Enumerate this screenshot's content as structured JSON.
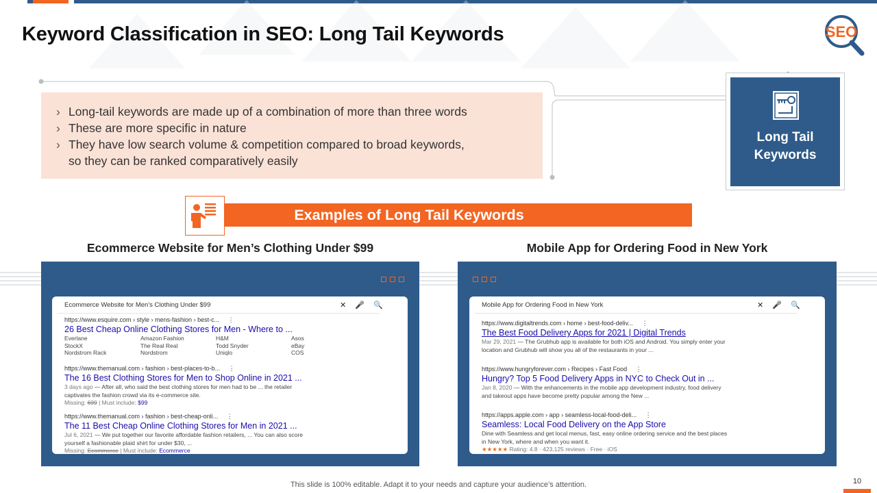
{
  "slide": {
    "title": "Keyword Classification in SEO: Long Tail Keywords",
    "logo_text": "SEO",
    "footer": "This slide is 100% editable. Adapt it to your needs and capture your audience’s attention.",
    "page_number": "10"
  },
  "bullets": [
    "Long-tail keywords are made up of a combination of more than three words",
    "These are more specific in nature",
    "They have low search volume & competition compared to broad keywords,",
    "so they can be ranked comparatively easily"
  ],
  "bullet_marker": "›",
  "keyword_box": {
    "line1": "Long Tail",
    "line2": "Keywords",
    "icon": "key-icon"
  },
  "examples_header": {
    "title": "Examples of Long Tail Keywords",
    "icon": "presenter-icon"
  },
  "left": {
    "caption": "Ecommerce Website for Men’s Clothing Under $99",
    "search": {
      "query": "Ecommerce Website for Men's Clothing Under $99",
      "clear": "✕",
      "mic": "🎤",
      "search": "🔍"
    },
    "results": [
      {
        "url": "https://www.esquire.com › style › mens-fashion › best-c...",
        "more": "⋮",
        "title": "26 Best Cheap Online Clothing Stores for Men - Where to ...",
        "grid": [
          "Everlane",
          "Amazon Fashion",
          "H&M",
          "Asos",
          "StockX",
          "The Real Real",
          "Todd Snyder",
          "eBay",
          "Nordstrom Rack",
          "Nordstrom",
          "Uniqlo",
          "COS"
        ]
      },
      {
        "url": "https://www.themanual.com › fashion › best-places-to-b...",
        "more": "⋮",
        "title": "The 16 Best Clothing Stores for Men to Shop Online in 2021 ...",
        "snippet1_date": "3 days ago",
        "snippet1": " — After all, who said the best clothing stores for men had to be ... the retailer",
        "snippet2": "captivates the fashion crowd via its e-commerce site.",
        "missing_label": "Missing: ",
        "missing_term": "699",
        "must_label": " | Must include: ",
        "must_term": "$99"
      },
      {
        "url": "https://www.themanual.com › fashion › best-cheap-onli...",
        "more": "⋮",
        "title": "The 11 Best Cheap Online Clothing Stores for Men in 2021 ...",
        "snippet1_date": "Jul 6, 2021",
        "snippet1": " — We put together our favorite affordable fashion retailers, ... You can also score",
        "snippet2": "yourself a fashionable plaid shirt for under $30, ...",
        "missing_label": "Missing: ",
        "missing_term": "Ecommerce",
        "must_label": " | Must include: ",
        "must_term": "Ecommerce"
      }
    ]
  },
  "right": {
    "caption": "Mobile App for Ordering Food in New York",
    "search": {
      "query": "Mobile App for Ordering Food in New York",
      "clear": "✕",
      "mic": "🎤",
      "search": "🔍"
    },
    "results": [
      {
        "url": "https://www.digitaltrends.com › home › best-food-deliv...",
        "more": "⋮",
        "title": "The Best Food Delivery Apps for 2021 | Digital Trends",
        "snippet1_date": "Mar 29, 2021",
        "snippet1": " — The Grubhub app is available for both iOS and Android. You simply enter your",
        "snippet2": "location and Grubhub will show you all of the restaurants in your ..."
      },
      {
        "url": "https://www.hungryforever.com › Recipes › Fast Food",
        "more": "⋮",
        "title": "Hungry? Top 5 Food Delivery Apps in NYC to Check Out in ...",
        "snippet1_date": "Jan 8, 2020",
        "snippet1": " — With the enhancements in the mobile app development industry, food delivery",
        "snippet2": "and takeout apps have become pretty popular among the New ..."
      },
      {
        "url": "https://apps.apple.com › app › seamless-local-food-deli...",
        "more": "⋮",
        "title": "Seamless: Local Food Delivery on the App Store",
        "snippet1_date": "",
        "snippet1": "Dine with Seamless and get local menus, fast, easy online ordering service and the best places",
        "snippet2": "in New York, where and when you want it.",
        "stars": "★★★★★",
        "rating": " Rating: 4.8 · 423,125 reviews · Free · iOS"
      }
    ]
  },
  "colors": {
    "navy": "#2e5b8a",
    "orange": "#f26522",
    "peach": "#fbe2d7",
    "link": "#1a0dab"
  }
}
